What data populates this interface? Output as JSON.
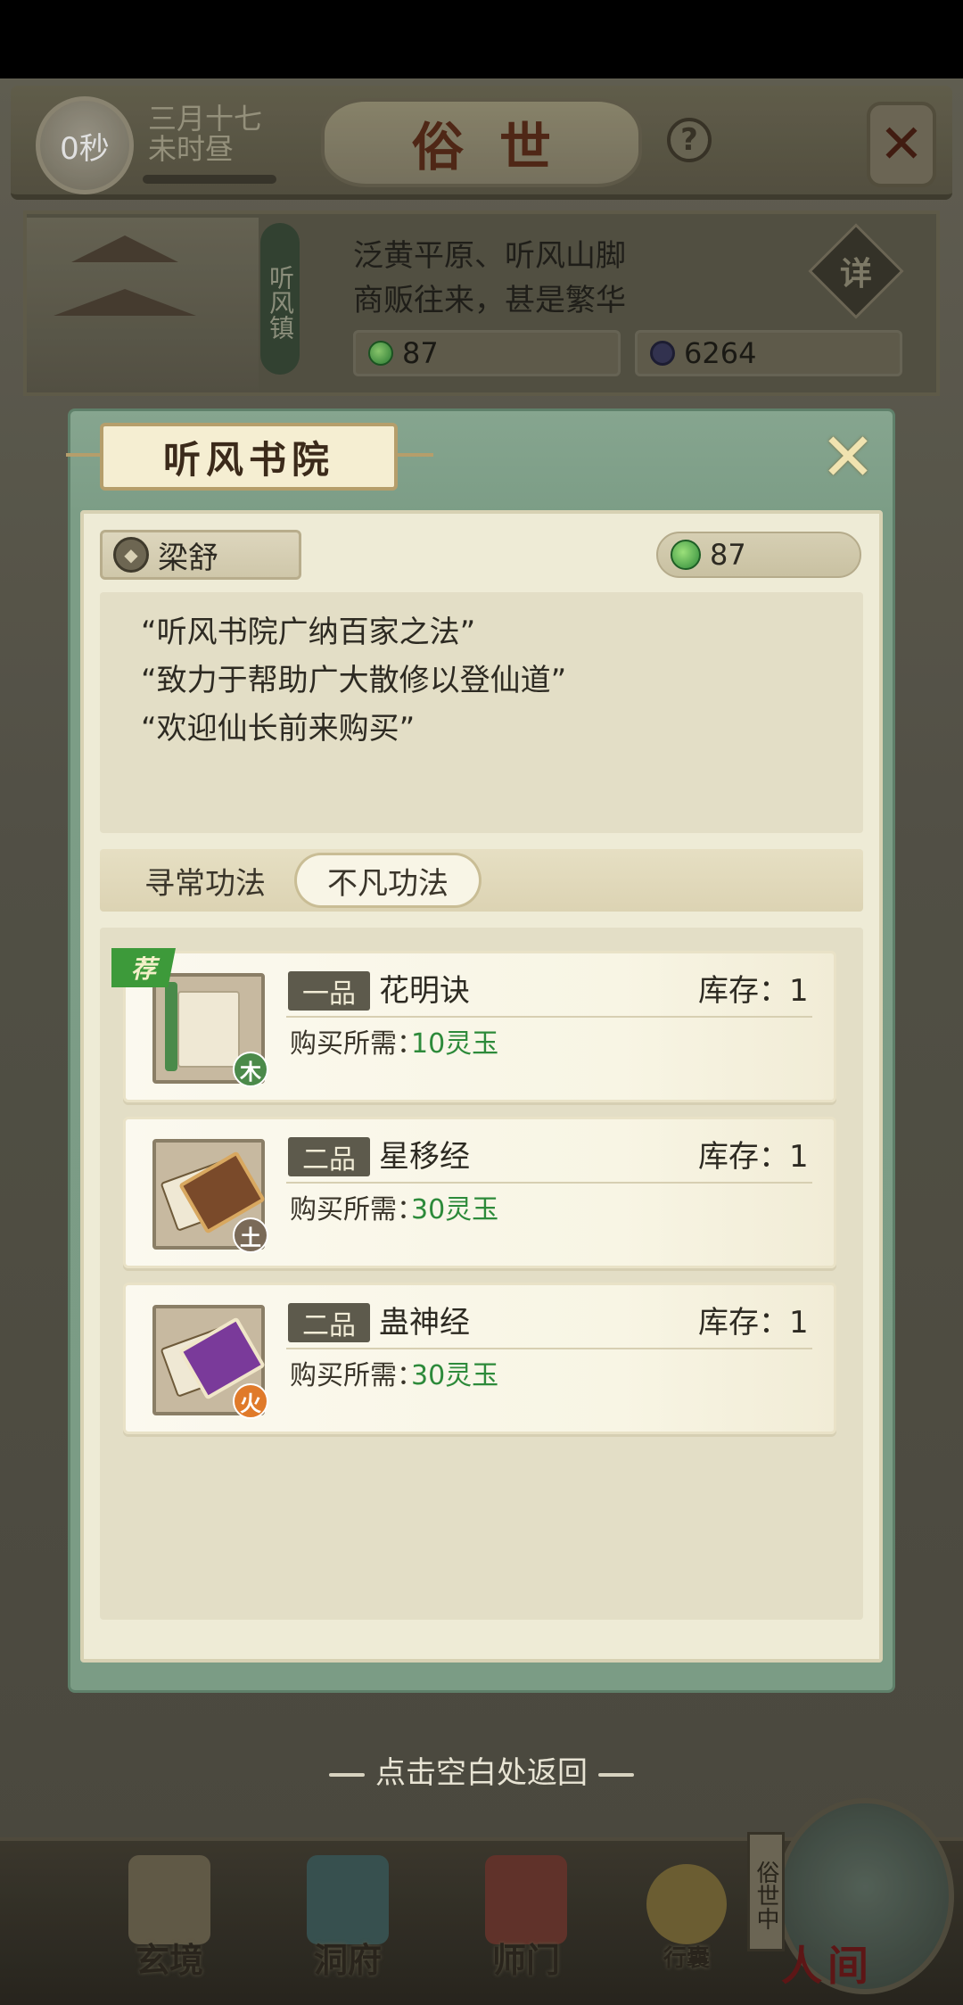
{
  "header": {
    "timer": "0秒",
    "date_line1": "三月十七",
    "date_line2": "未时昼",
    "title": "俗世",
    "help_label": "?",
    "close_label": "✕"
  },
  "town": {
    "name": "听风镇",
    "desc_line1": "泛黄平原、听风山脚",
    "desc_line2": "商贩往来，甚是繁华",
    "jade": "87",
    "coins": "6264",
    "detail_label": "详"
  },
  "modal": {
    "title": "听风书院",
    "close_label": "✕",
    "npc_name": "梁舒",
    "jade_balance": "87",
    "speech": [
      "“听风书院广纳百家之法”",
      "“致力于帮助广大散修以登仙道”",
      "“欢迎仙长前来购买”"
    ],
    "tabs": [
      {
        "label": "寻常功法",
        "active": false
      },
      {
        "label": "不凡功法",
        "active": true
      }
    ],
    "items": [
      {
        "rank": "一品",
        "name": "花明诀",
        "stock_label": "库存：",
        "stock": "1",
        "cost_label": "购买所需：",
        "cost": "10灵玉",
        "element": "木",
        "element_color": "#4b8a4a",
        "recommended": true,
        "rec_label": "荐"
      },
      {
        "rank": "二品",
        "name": "星移经",
        "stock_label": "库存：",
        "stock": "1",
        "cost_label": "购买所需：",
        "cost": "30灵玉",
        "element": "土",
        "element_color": "#7a6a58",
        "recommended": false
      },
      {
        "rank": "二品",
        "name": "蛊神经",
        "stock_label": "库存：",
        "stock": "1",
        "cost_label": "购买所需：",
        "cost": "30灵玉",
        "element": "火",
        "element_color": "#e07a2a",
        "recommended": false
      }
    ]
  },
  "return_hint": "点击空白处返回",
  "nav": {
    "items": [
      {
        "label": "玄境"
      },
      {
        "label": "洞府"
      },
      {
        "label": "师门"
      },
      {
        "label": "行囊"
      }
    ],
    "world_tag": "俗世中",
    "world_label": "人间"
  },
  "colors": {
    "modal_green": "#7b9c85",
    "jade_green": "#2d8a3a",
    "title_brown": "#5a2d1a"
  }
}
